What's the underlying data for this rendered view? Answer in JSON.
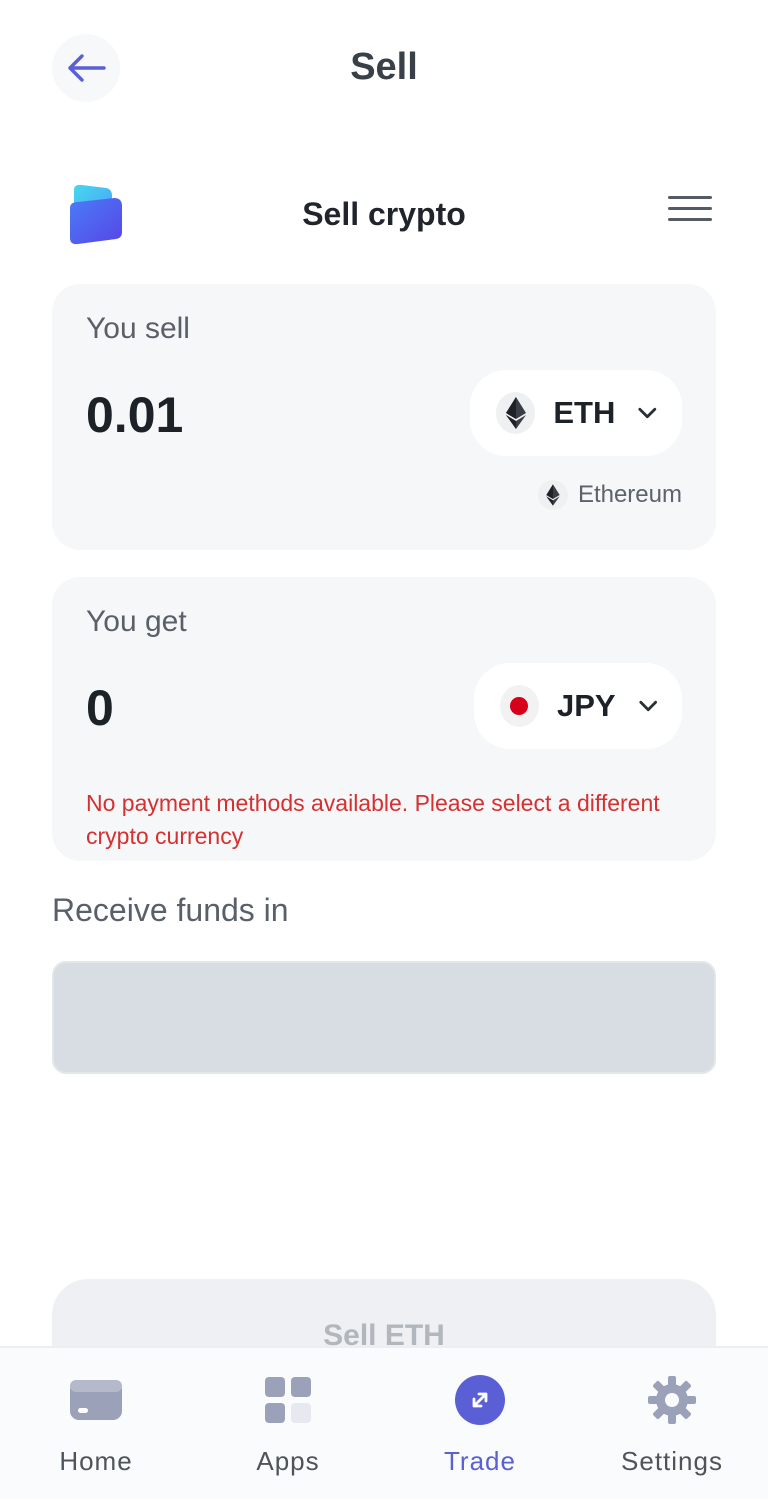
{
  "header": {
    "title": "Sell",
    "back_icon": "arrow-left-icon"
  },
  "widget": {
    "title": "Sell crypto",
    "menu_icon": "hamburger-menu-icon"
  },
  "sell_card": {
    "label": "You sell",
    "amount": "0.01",
    "currency_code": "ETH",
    "currency_icon": "ethereum-icon",
    "network_label": "Ethereum"
  },
  "get_card": {
    "label": "You get",
    "amount": "0",
    "currency_code": "JPY",
    "currency_icon": "japan-flag-icon",
    "error_message": "No payment methods available. Please select a different crypto currency"
  },
  "receive": {
    "label": "Receive funds in",
    "value": ""
  },
  "sell_button": {
    "label": "Sell ETH"
  },
  "bottom_nav": {
    "items": [
      {
        "label": "Home",
        "icon": "wallet-icon",
        "active": false
      },
      {
        "label": "Apps",
        "icon": "apps-grid-icon",
        "active": false
      },
      {
        "label": "Trade",
        "icon": "trade-swap-icon",
        "active": true
      },
      {
        "label": "Settings",
        "icon": "gear-icon",
        "active": false
      }
    ]
  },
  "colors": {
    "accent": "#5b5fd6",
    "error": "#d63030",
    "card_bg": "#f6f7f8",
    "disabled_field": "#d7dde2"
  }
}
